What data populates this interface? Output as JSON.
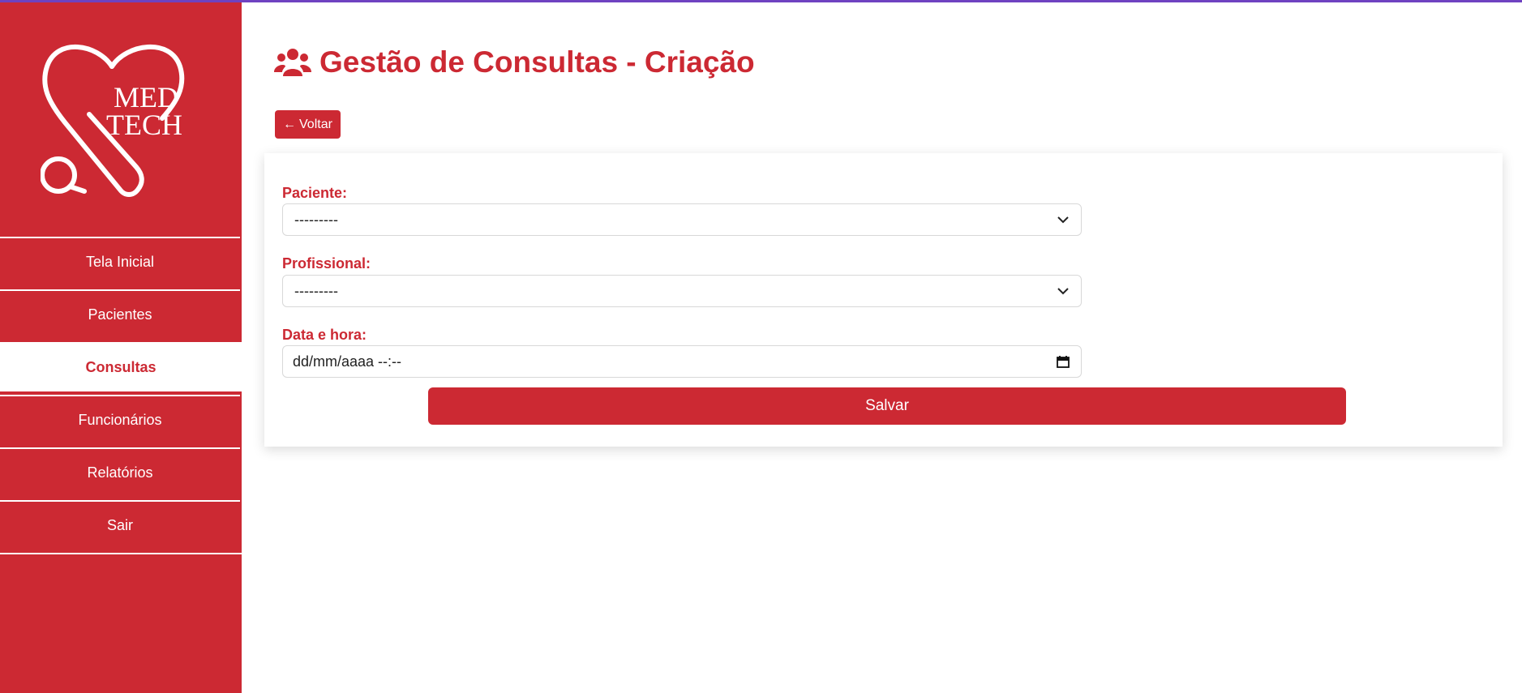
{
  "colors": {
    "brand_red": "#cc2933",
    "top_accent": "#6f42c1",
    "white": "#ffffff"
  },
  "logo": {
    "line1": "MED",
    "line2": "TECH",
    "icon": "heart-stethoscope-logo"
  },
  "sidebar": {
    "items": [
      {
        "label": "Tela Inicial",
        "active": false
      },
      {
        "label": "Pacientes",
        "active": false
      },
      {
        "label": "Consultas",
        "active": true
      },
      {
        "label": "Funcionários",
        "active": false
      },
      {
        "label": "Relatórios",
        "active": false
      },
      {
        "label": "Sair",
        "active": false
      }
    ]
  },
  "header": {
    "title": "Gestão de Consultas - Criação",
    "icon": "users-icon"
  },
  "back_button": {
    "label": "Voltar",
    "icon": "arrow-left-icon"
  },
  "form": {
    "paciente": {
      "label": "Paciente:",
      "value": "---------"
    },
    "profissional": {
      "label": "Profissional:",
      "value": "---------"
    },
    "data_hora": {
      "label": "Data e hora:",
      "value": "dd/mm/aaaa --:--",
      "icon": "calendar-icon"
    },
    "submit_label": "Salvar"
  }
}
